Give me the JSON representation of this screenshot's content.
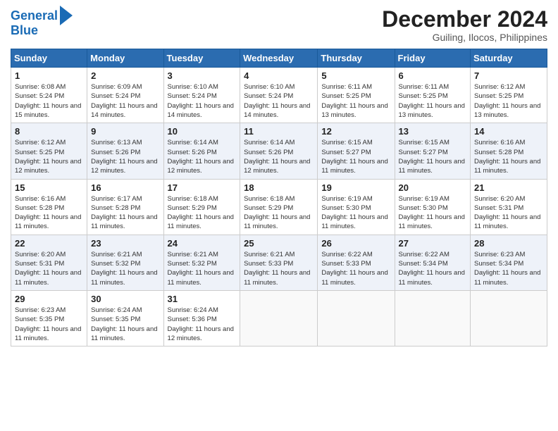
{
  "header": {
    "logo_line1": "General",
    "logo_line2": "Blue",
    "title": "December 2024",
    "subtitle": "Guiling, Ilocos, Philippines"
  },
  "calendar": {
    "days_of_week": [
      "Sunday",
      "Monday",
      "Tuesday",
      "Wednesday",
      "Thursday",
      "Friday",
      "Saturday"
    ],
    "weeks": [
      [
        null,
        null,
        null,
        null,
        null,
        null,
        null
      ],
      [
        null,
        null,
        null,
        null,
        null,
        null,
        null
      ],
      [
        null,
        null,
        null,
        null,
        null,
        null,
        null
      ],
      [
        null,
        null,
        null,
        null,
        null,
        null,
        null
      ],
      [
        null,
        null,
        null,
        null,
        null,
        null,
        null
      ]
    ],
    "cells": [
      {
        "day": 1,
        "col": 0,
        "row": 0,
        "sunrise": "6:08 AM",
        "sunset": "5:24 PM",
        "daylight": "11 hours and 15 minutes."
      },
      {
        "day": 2,
        "col": 1,
        "row": 0,
        "sunrise": "6:09 AM",
        "sunset": "5:24 PM",
        "daylight": "11 hours and 14 minutes."
      },
      {
        "day": 3,
        "col": 2,
        "row": 0,
        "sunrise": "6:10 AM",
        "sunset": "5:24 PM",
        "daylight": "11 hours and 14 minutes."
      },
      {
        "day": 4,
        "col": 3,
        "row": 0,
        "sunrise": "6:10 AM",
        "sunset": "5:24 PM",
        "daylight": "11 hours and 14 minutes."
      },
      {
        "day": 5,
        "col": 4,
        "row": 0,
        "sunrise": "6:11 AM",
        "sunset": "5:25 PM",
        "daylight": "11 hours and 13 minutes."
      },
      {
        "day": 6,
        "col": 5,
        "row": 0,
        "sunrise": "6:11 AM",
        "sunset": "5:25 PM",
        "daylight": "11 hours and 13 minutes."
      },
      {
        "day": 7,
        "col": 6,
        "row": 0,
        "sunrise": "6:12 AM",
        "sunset": "5:25 PM",
        "daylight": "11 hours and 13 minutes."
      },
      {
        "day": 8,
        "col": 0,
        "row": 1,
        "sunrise": "6:12 AM",
        "sunset": "5:25 PM",
        "daylight": "11 hours and 12 minutes."
      },
      {
        "day": 9,
        "col": 1,
        "row": 1,
        "sunrise": "6:13 AM",
        "sunset": "5:26 PM",
        "daylight": "11 hours and 12 minutes."
      },
      {
        "day": 10,
        "col": 2,
        "row": 1,
        "sunrise": "6:14 AM",
        "sunset": "5:26 PM",
        "daylight": "11 hours and 12 minutes."
      },
      {
        "day": 11,
        "col": 3,
        "row": 1,
        "sunrise": "6:14 AM",
        "sunset": "5:26 PM",
        "daylight": "11 hours and 12 minutes."
      },
      {
        "day": 12,
        "col": 4,
        "row": 1,
        "sunrise": "6:15 AM",
        "sunset": "5:27 PM",
        "daylight": "11 hours and 11 minutes."
      },
      {
        "day": 13,
        "col": 5,
        "row": 1,
        "sunrise": "6:15 AM",
        "sunset": "5:27 PM",
        "daylight": "11 hours and 11 minutes."
      },
      {
        "day": 14,
        "col": 6,
        "row": 1,
        "sunrise": "6:16 AM",
        "sunset": "5:28 PM",
        "daylight": "11 hours and 11 minutes."
      },
      {
        "day": 15,
        "col": 0,
        "row": 2,
        "sunrise": "6:16 AM",
        "sunset": "5:28 PM",
        "daylight": "11 hours and 11 minutes."
      },
      {
        "day": 16,
        "col": 1,
        "row": 2,
        "sunrise": "6:17 AM",
        "sunset": "5:28 PM",
        "daylight": "11 hours and 11 minutes."
      },
      {
        "day": 17,
        "col": 2,
        "row": 2,
        "sunrise": "6:18 AM",
        "sunset": "5:29 PM",
        "daylight": "11 hours and 11 minutes."
      },
      {
        "day": 18,
        "col": 3,
        "row": 2,
        "sunrise": "6:18 AM",
        "sunset": "5:29 PM",
        "daylight": "11 hours and 11 minutes."
      },
      {
        "day": 19,
        "col": 4,
        "row": 2,
        "sunrise": "6:19 AM",
        "sunset": "5:30 PM",
        "daylight": "11 hours and 11 minutes."
      },
      {
        "day": 20,
        "col": 5,
        "row": 2,
        "sunrise": "6:19 AM",
        "sunset": "5:30 PM",
        "daylight": "11 hours and 11 minutes."
      },
      {
        "day": 21,
        "col": 6,
        "row": 2,
        "sunrise": "6:20 AM",
        "sunset": "5:31 PM",
        "daylight": "11 hours and 11 minutes."
      },
      {
        "day": 22,
        "col": 0,
        "row": 3,
        "sunrise": "6:20 AM",
        "sunset": "5:31 PM",
        "daylight": "11 hours and 11 minutes."
      },
      {
        "day": 23,
        "col": 1,
        "row": 3,
        "sunrise": "6:21 AM",
        "sunset": "5:32 PM",
        "daylight": "11 hours and 11 minutes."
      },
      {
        "day": 24,
        "col": 2,
        "row": 3,
        "sunrise": "6:21 AM",
        "sunset": "5:32 PM",
        "daylight": "11 hours and 11 minutes."
      },
      {
        "day": 25,
        "col": 3,
        "row": 3,
        "sunrise": "6:21 AM",
        "sunset": "5:33 PM",
        "daylight": "11 hours and 11 minutes."
      },
      {
        "day": 26,
        "col": 4,
        "row": 3,
        "sunrise": "6:22 AM",
        "sunset": "5:33 PM",
        "daylight": "11 hours and 11 minutes."
      },
      {
        "day": 27,
        "col": 5,
        "row": 3,
        "sunrise": "6:22 AM",
        "sunset": "5:34 PM",
        "daylight": "11 hours and 11 minutes."
      },
      {
        "day": 28,
        "col": 6,
        "row": 3,
        "sunrise": "6:23 AM",
        "sunset": "5:34 PM",
        "daylight": "11 hours and 11 minutes."
      },
      {
        "day": 29,
        "col": 0,
        "row": 4,
        "sunrise": "6:23 AM",
        "sunset": "5:35 PM",
        "daylight": "11 hours and 11 minutes."
      },
      {
        "day": 30,
        "col": 1,
        "row": 4,
        "sunrise": "6:24 AM",
        "sunset": "5:35 PM",
        "daylight": "11 hours and 11 minutes."
      },
      {
        "day": 31,
        "col": 2,
        "row": 4,
        "sunrise": "6:24 AM",
        "sunset": "5:36 PM",
        "daylight": "11 hours and 12 minutes."
      }
    ]
  }
}
